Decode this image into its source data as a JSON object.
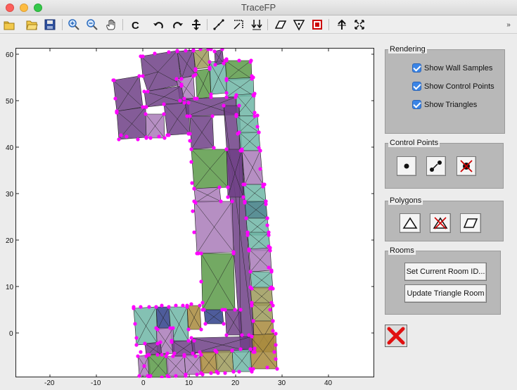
{
  "window": {
    "title": "TraceFP"
  },
  "toolbar": {
    "buttons": [
      {
        "name": "new-file-icon"
      },
      {
        "name": "open-folder-icon"
      },
      {
        "name": "save-icon"
      },
      {
        "name": "zoom-in-icon"
      },
      {
        "name": "zoom-out-icon"
      },
      {
        "name": "pan-hand-icon"
      },
      {
        "name": "c-tool-icon"
      },
      {
        "name": "undo-icon"
      },
      {
        "name": "redo-icon"
      },
      {
        "name": "fill-tool-icon"
      },
      {
        "name": "line-tool-icon"
      },
      {
        "name": "corner-tool-icon"
      },
      {
        "name": "merge-tool-icon"
      },
      {
        "name": "polygon-tool-icon"
      },
      {
        "name": "triangle-tool-icon"
      },
      {
        "name": "red-square-tool-icon"
      },
      {
        "name": "split-arrow-icon"
      },
      {
        "name": "expand-icon"
      }
    ],
    "overflow": "»"
  },
  "plot": {
    "x_ticks": [
      "-20",
      "-10",
      "0",
      "10",
      "20",
      "30",
      "40"
    ],
    "y_ticks": [
      "60",
      "50",
      "40",
      "30",
      "20",
      "10",
      "0"
    ]
  },
  "rendering": {
    "title": "Rendering",
    "show_wall_samples": "Show Wall Samples",
    "show_control_points": "Show Control Points",
    "show_triangles": "Show Triangles"
  },
  "control_points": {
    "title": "Control Points"
  },
  "polygons": {
    "title": "Polygons"
  },
  "rooms": {
    "title": "Rooms",
    "set_room_id": "Set Current Room ID...",
    "update_triangle_room": "Update Triangle Room"
  },
  "colors": {
    "purple": "#6e3f86",
    "lavender": "#a97bb8",
    "green": "#5a9a48",
    "teal": "#6fb6a6",
    "steelteal": "#3e7d84",
    "navy": "#2f3f8a",
    "olive": "#a88a3c",
    "khaki": "#9c9a5a",
    "control_point": "#ff00ff",
    "close_red": "#e11010"
  }
}
